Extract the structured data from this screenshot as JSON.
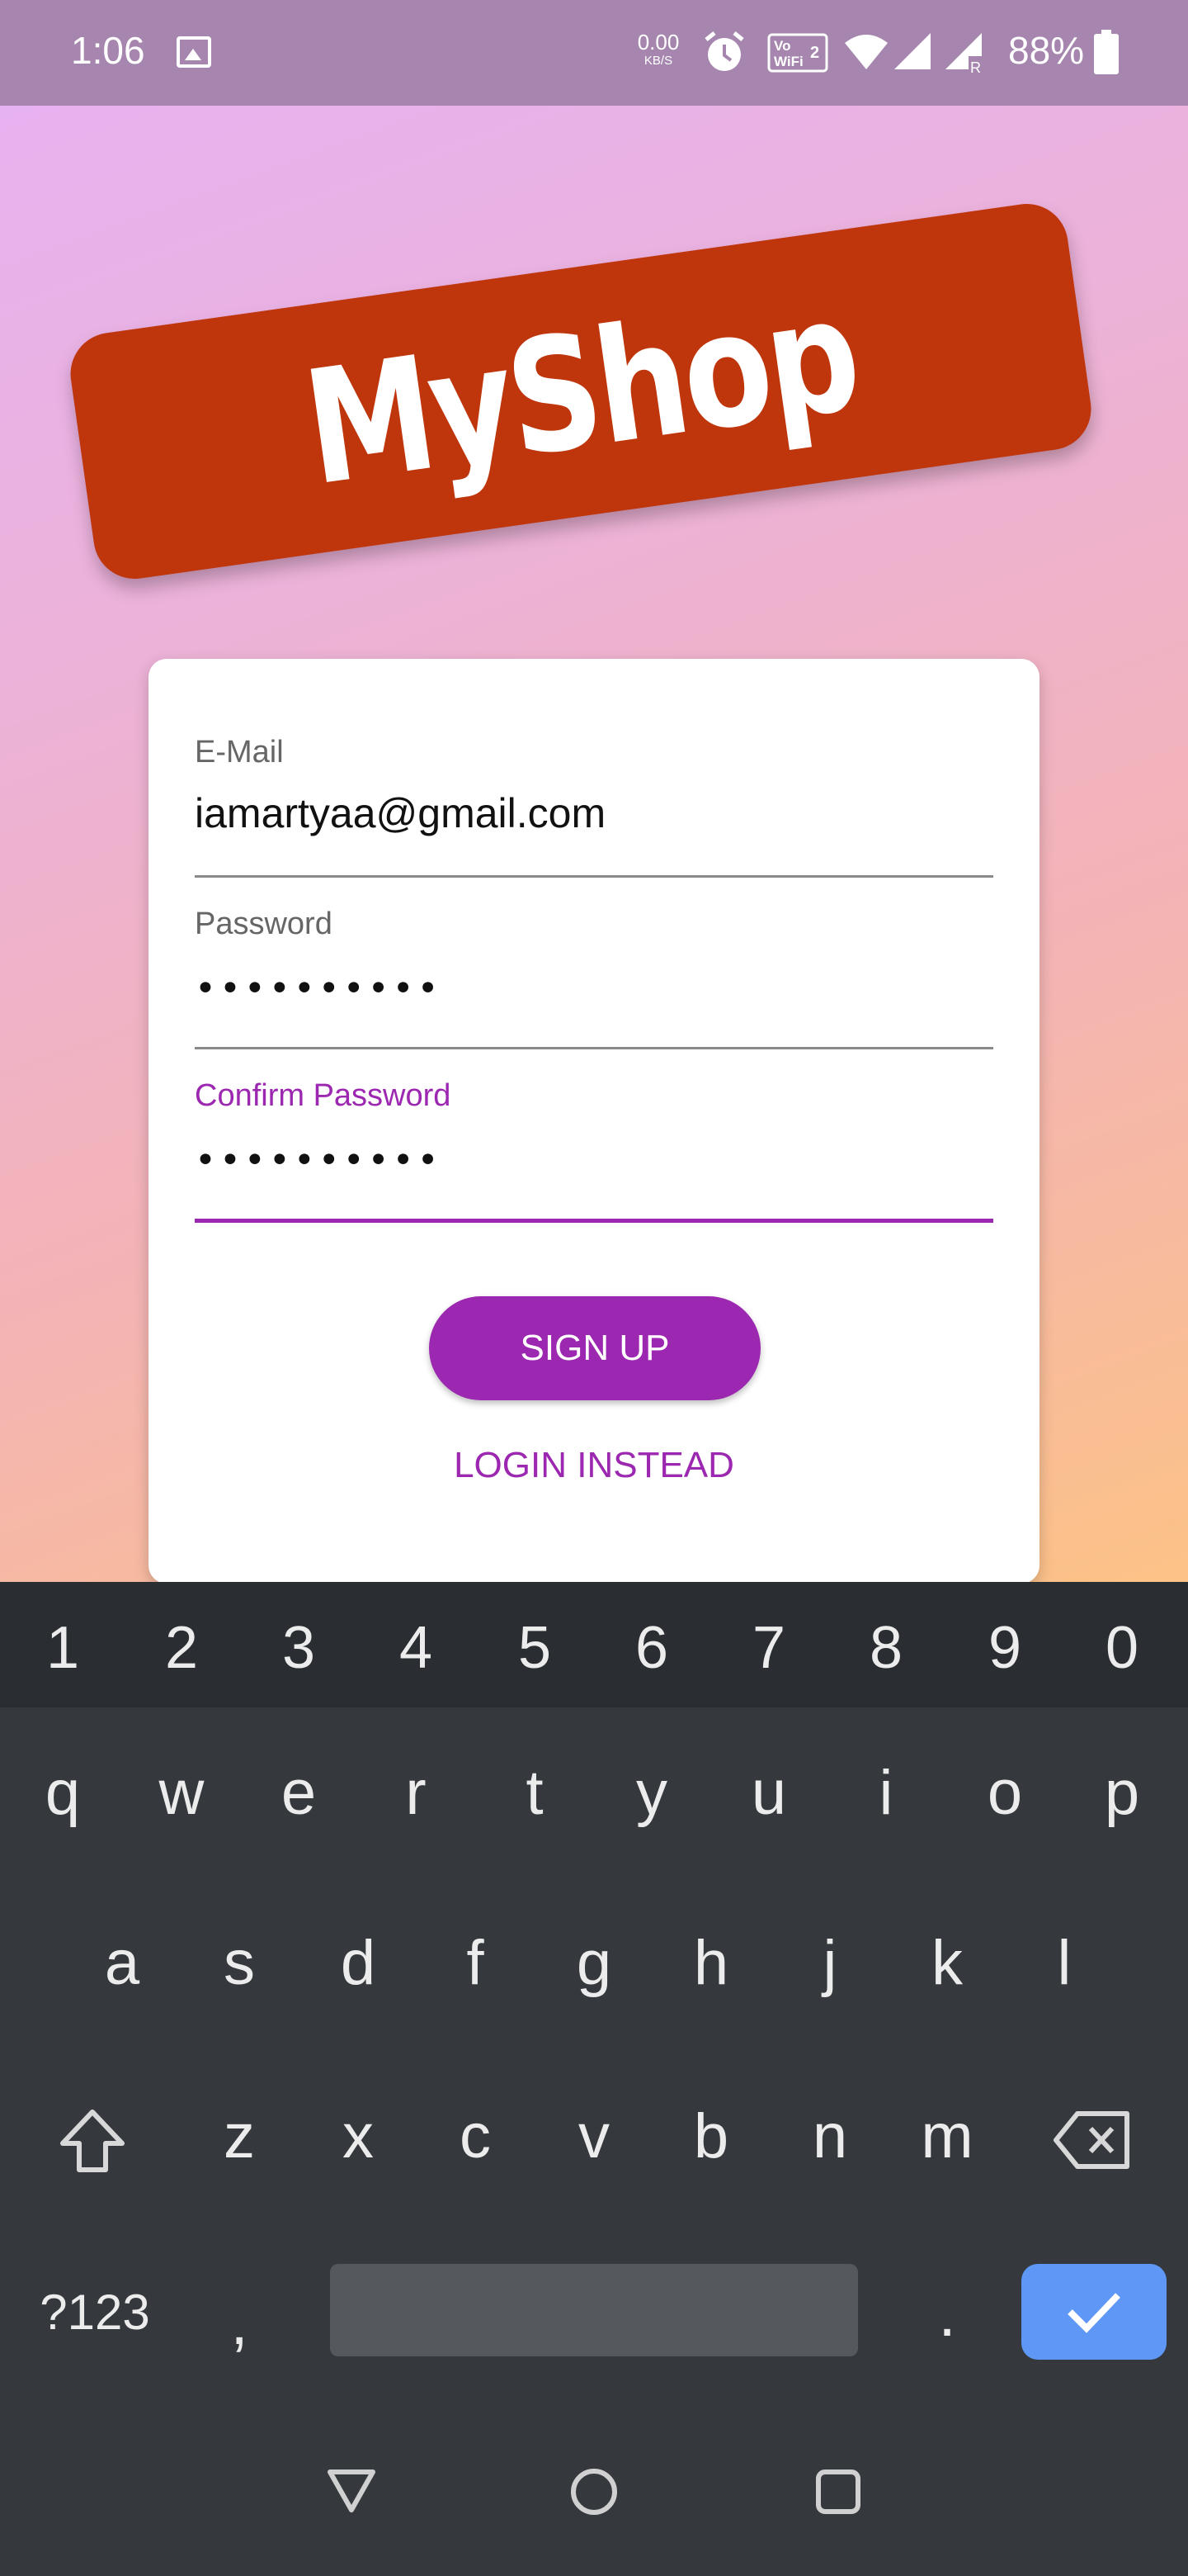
{
  "status_bar": {
    "time": "1:06",
    "net_speed_value": "0.00",
    "net_speed_unit": "KB/S",
    "battery": "88%",
    "icons": [
      "gallery-icon",
      "alarm-icon",
      "vowifi-icon",
      "wifi-icon",
      "signal-icon",
      "signal-r-icon",
      "battery-icon"
    ]
  },
  "logo": {
    "text": "MyShop",
    "color": "#bf360c"
  },
  "form": {
    "email": {
      "label": "E-Mail",
      "value": "iamartyaa@gmail.com"
    },
    "password": {
      "label": "Password",
      "value": "••••••••••"
    },
    "confirm_password": {
      "label": "Confirm Password",
      "value": "••••••••••"
    },
    "signup_label": "SIGN UP",
    "login_instead_label": "LOGIN INSTEAD",
    "accent": "#9c27b0"
  },
  "keyboard": {
    "numbers": [
      "1",
      "2",
      "3",
      "4",
      "5",
      "6",
      "7",
      "8",
      "9",
      "0"
    ],
    "row1": [
      "q",
      "w",
      "e",
      "r",
      "t",
      "y",
      "u",
      "i",
      "o",
      "p"
    ],
    "row2": [
      "a",
      "s",
      "d",
      "f",
      "g",
      "h",
      "j",
      "k",
      "l"
    ],
    "row3": [
      "z",
      "x",
      "c",
      "v",
      "b",
      "n",
      "m"
    ],
    "symbols_label": "?123",
    "comma": ",",
    "period": ".",
    "enter_color": "#5e97f6"
  }
}
